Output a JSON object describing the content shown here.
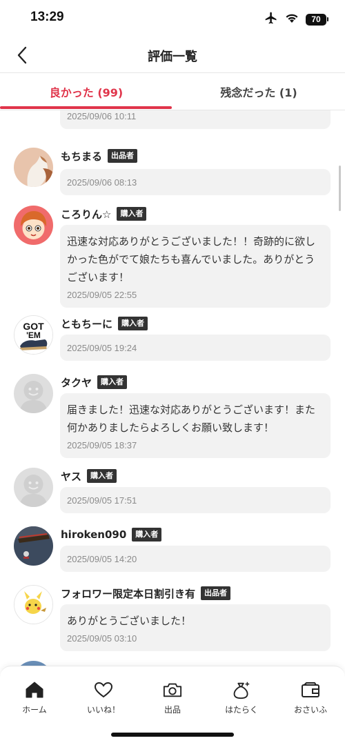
{
  "status_bar": {
    "time": "13:29",
    "battery": "70"
  },
  "header": {
    "title": "評価一覧"
  },
  "tabs": [
    {
      "label": "良かった (99)"
    },
    {
      "label": "残念だった (1)"
    }
  ],
  "reviews": [
    {
      "name": "",
      "role": "",
      "comment": "",
      "timestamp": "2025/09/06 10:11"
    },
    {
      "name": "もちまる",
      "role": "出品者",
      "comment": "",
      "timestamp": "2025/09/06 08:13"
    },
    {
      "name": "ころりん☆",
      "role": "購入者",
      "comment": "迅速な対応ありがとうございました！！奇跡的に欲しかった色がでて娘たちも喜んでいました。ありがとうございます！",
      "timestamp": "2025/09/05 22:55"
    },
    {
      "name": "ともちーに",
      "role": "購入者",
      "comment": "",
      "timestamp": "2025/09/05 19:24"
    },
    {
      "name": "タクヤ",
      "role": "購入者",
      "comment": "届きました！迅速な対応ありがとうございます！また何かありましたらよろしくお願い致します！",
      "timestamp": "2025/09/05 18:37"
    },
    {
      "name": "ヤス",
      "role": "購入者",
      "comment": "",
      "timestamp": "2025/09/05 17:51"
    },
    {
      "name": "hiroken090",
      "role": "購入者",
      "comment": "",
      "timestamp": "2025/09/05 14:20"
    },
    {
      "name": "フォロワー限定本日割引き有",
      "role": "出品者",
      "comment": "ありがとうございました！",
      "timestamp": "2025/09/05 03:10"
    }
  ],
  "avatar_text": {
    "gotem_line1": "GOT",
    "gotem_line2": "'EM"
  },
  "bottom_nav": [
    {
      "label": "ホーム",
      "icon": "home-icon"
    },
    {
      "label": "いいね！",
      "icon": "heart-icon"
    },
    {
      "label": "出品",
      "icon": "camera-icon"
    },
    {
      "label": "はたらく",
      "icon": "money-bag-icon"
    },
    {
      "label": "おさいふ",
      "icon": "wallet-icon"
    }
  ],
  "colors": {
    "accent": "#e0344a",
    "badge": "#333333",
    "bubble": "#f2f2f2"
  }
}
